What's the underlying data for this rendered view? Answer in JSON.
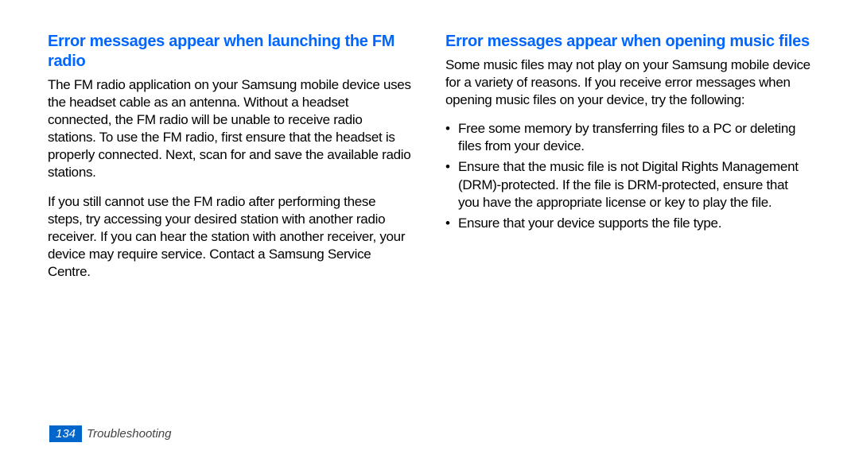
{
  "left": {
    "heading": "Error messages appear when launching the FM radio",
    "p1": "The FM radio application on your Samsung mobile device uses the headset cable as an antenna. Without a headset connected, the FM radio will be unable to receive radio stations. To use the FM radio, ﬁrst ensure that the headset is properly connected. Next, scan for and save the available radio stations.",
    "p2": "If you still cannot use the FM radio after performing these steps, try accessing your desired station with another radio receiver. If you can hear the station with another receiver, your device may require service. Contact a Samsung Service Centre."
  },
  "right": {
    "heading": "Error messages appear when opening music ﬁles",
    "p1": "Some music ﬁles may not play on your Samsung mobile device for a variety of reasons. If you receive error messages when opening music ﬁles on your device, try the following:",
    "bullets": [
      "Free some memory by transferring ﬁles to a PC or deleting ﬁles from your device.",
      "Ensure that the music ﬁle is not Digital Rights Management (DRM)-protected. If the ﬁle is DRM-protected, ensure that you have the appropriate license or key to play the ﬁle.",
      "Ensure that your device supports the ﬁle type."
    ]
  },
  "footer": {
    "page": "134",
    "section": "Troubleshooting"
  }
}
